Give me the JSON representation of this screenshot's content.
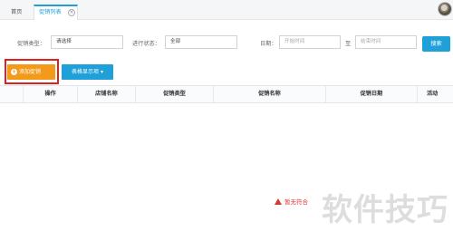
{
  "tabs": {
    "home": "首页",
    "active": "促销列表",
    "close_icon": "×"
  },
  "filters": {
    "promo_type_label": "促销类型：",
    "promo_type_value": "请选择",
    "status_label": "进行状态：",
    "status_value": "全部",
    "date_label": "日期：",
    "start_placeholder": "开始时间",
    "to_label": "至",
    "end_placeholder": "结束时间",
    "search_label": "搜索"
  },
  "toolbar": {
    "add_label": "添加促销",
    "display_label": "表格显示项 ▾"
  },
  "table": {
    "columns": [
      "",
      "操作",
      "店铺名称",
      "促销类型",
      "促销名称",
      "促销日期",
      "活动"
    ]
  },
  "empty_text": "暂无符合",
  "watermark": "软件技巧",
  "colors": {
    "primary": "#1fa0d8",
    "add_button": "#f39a1b",
    "highlight": "#e02020"
  }
}
